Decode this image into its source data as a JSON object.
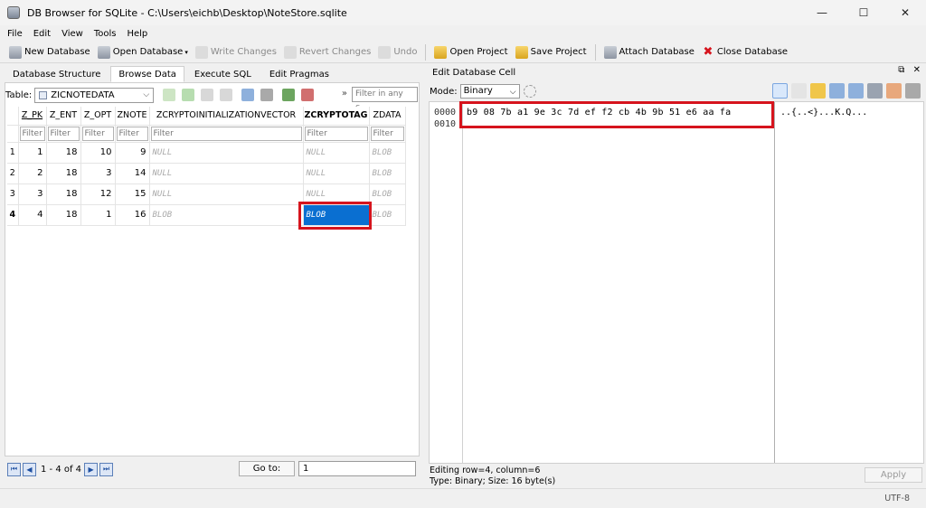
{
  "window": {
    "title": "DB Browser for SQLite - C:\\Users\\eichb\\Desktop\\NoteStore.sqlite",
    "minimize": "—",
    "maximize": "☐",
    "close": "✕"
  },
  "menu": [
    "File",
    "Edit",
    "View",
    "Tools",
    "Help"
  ],
  "toolbar": {
    "new_database": "New Database",
    "open_database": "Open Database",
    "write_changes": "Write Changes",
    "revert_changes": "Revert Changes",
    "undo": "Undo",
    "open_project": "Open Project",
    "save_project": "Save Project",
    "attach_database": "Attach Database",
    "close_database": "Close Database"
  },
  "tabs": [
    "Database Structure",
    "Browse Data",
    "Execute SQL",
    "Edit Pragmas"
  ],
  "browse": {
    "table_label": "Table:",
    "table_name": "ZICNOTEDATA",
    "filter_any_placeholder": "Filter in any c...",
    "filter_placeholder": "Filter",
    "columns": [
      "Z_PK",
      "Z_ENT",
      "Z_OPT",
      "ZNOTE",
      "ZCRYPTOINITIALIZATIONVECTOR",
      "ZCRYPTOTAG",
      "ZDATA"
    ],
    "rows": [
      {
        "num": "1",
        "cells": [
          "1",
          "18",
          "10",
          "9",
          "NULL",
          "NULL",
          "BLOB"
        ]
      },
      {
        "num": "2",
        "cells": [
          "2",
          "18",
          "3",
          "14",
          "NULL",
          "NULL",
          "BLOB"
        ]
      },
      {
        "num": "3",
        "cells": [
          "3",
          "18",
          "12",
          "15",
          "NULL",
          "NULL",
          "BLOB"
        ]
      },
      {
        "num": "4",
        "cells": [
          "4",
          "18",
          "1",
          "16",
          "BLOB",
          "BLOB",
          "BLOB"
        ]
      }
    ],
    "record_count": "1 - 4 of 4",
    "goto_label": "Go to:",
    "goto_value": "1"
  },
  "edit_cell": {
    "title": "Edit Database Cell",
    "mode_label": "Mode:",
    "mode_value": "Binary",
    "offsets": [
      "0000",
      "0010"
    ],
    "hex_bytes": "b9 08 7b a1 9e 3c 7d ef f2 cb 4b 9b 51 e6 aa fa",
    "ascii": "..{..<}...K.Q...",
    "status_line1": "Editing row=4, column=6",
    "status_line2": "Type: Binary; Size:  16 byte(s)",
    "apply": "Apply"
  },
  "statusbar": {
    "encoding": "UTF-8"
  },
  "colors": {
    "highlight": "#d6141d",
    "selection": "#0a6fd1"
  }
}
